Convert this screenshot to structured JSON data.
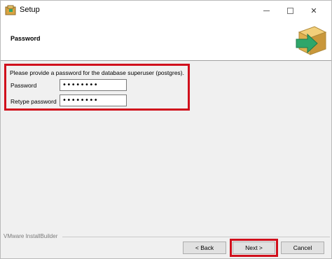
{
  "window": {
    "title": "Setup",
    "controls": {
      "minimize": "—",
      "maximize": "☐",
      "close": "✕"
    }
  },
  "header": {
    "title": "Password",
    "logo_icon": "package-arrow-icon"
  },
  "form": {
    "prompt": "Please provide a password for the database superuser (postgres).",
    "password_label": "Password",
    "password_value": "••••••••",
    "retype_label": "Retype password",
    "retype_value": "••••••••"
  },
  "footer": {
    "brand": "VMware InstallBuilder",
    "back_label": "< Back",
    "next_label": "Next >",
    "cancel_label": "Cancel"
  },
  "colors": {
    "highlight": "#d0101c",
    "background": "#f0f0f0",
    "logo_box": "#e8b84a",
    "logo_arrow": "#2fa66a"
  }
}
